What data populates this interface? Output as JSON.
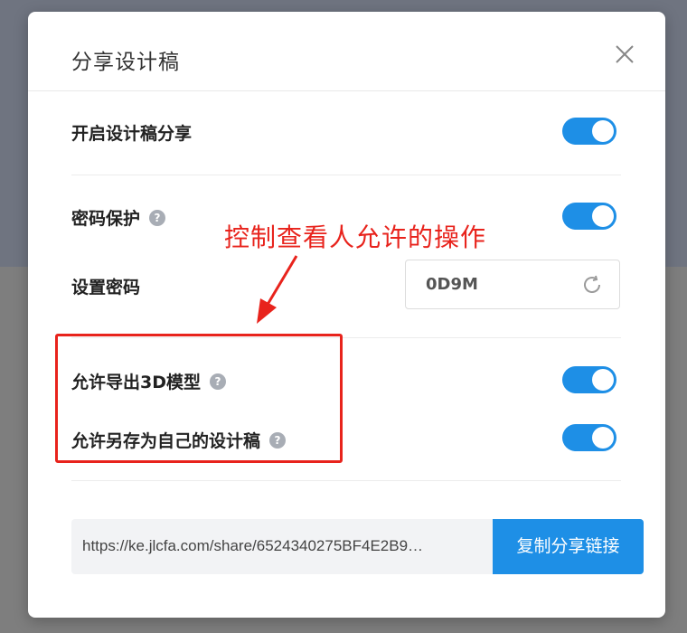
{
  "dialog": {
    "title": "分享设计稿"
  },
  "settings": {
    "enable_share": {
      "label": "开启设计稿分享",
      "on": true
    },
    "password_protect": {
      "label": "密码保护",
      "help": "?",
      "on": true
    },
    "set_password": {
      "label": "设置密码",
      "value": "0D9M"
    },
    "allow_export_3d": {
      "label": "允许导出3D模型",
      "help": "?",
      "on": true
    },
    "allow_save_as_own": {
      "label": "允许另存为自己的设计稿",
      "help": "?",
      "on": true
    }
  },
  "annotation": {
    "text": "控制查看人允许的操作",
    "color": "#e8231c"
  },
  "share": {
    "url": "https://ke.jlcfa.com/share/6524340275BF4E2B9…",
    "copy_label": "复制分享链接"
  },
  "colors": {
    "accent": "#1e8fe6",
    "annotation": "#e8231c"
  },
  "icons": {
    "close": "close-icon",
    "refresh": "refresh-icon",
    "help": "help-icon"
  }
}
